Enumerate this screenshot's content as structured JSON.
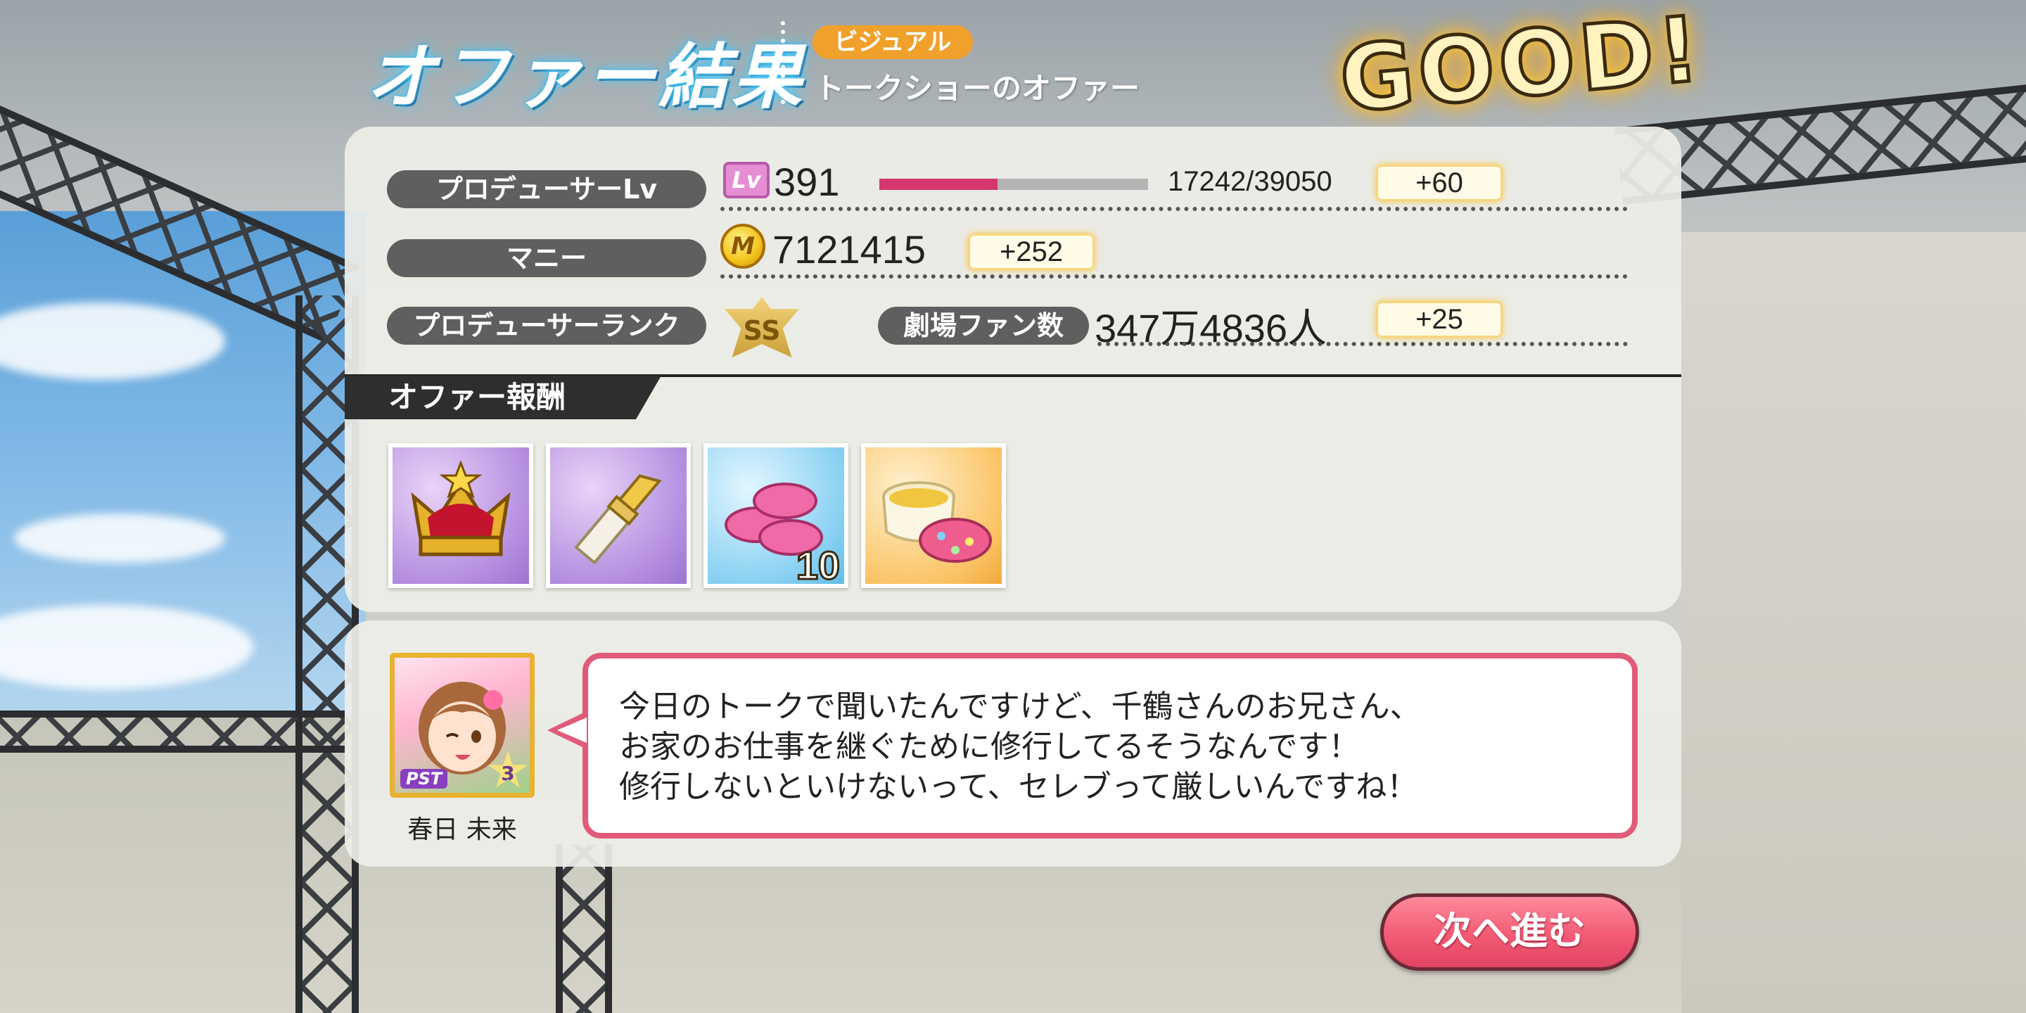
{
  "header": {
    "title": "オファー結果",
    "type_badge": "ビジュアル",
    "offer_name": "トークショーのオファー",
    "result": "GOOD!"
  },
  "stats": {
    "producer_lv": {
      "label": "プロデューサーLv",
      "icon": "Lv",
      "value": "391",
      "exp": "17242/39050",
      "exp_progress_fraction": 0.44,
      "gain": "+60",
      "progress_color": "#d4366e"
    },
    "money": {
      "label": "マニー",
      "icon": "M",
      "value": "7121415",
      "gain": "+252"
    },
    "rank": {
      "label": "プロデューサーランク",
      "badge": "SS"
    },
    "fans": {
      "label": "劇場ファン数",
      "value": "347万4836人",
      "gain": "+25"
    }
  },
  "rewards": {
    "section_label": "オファー報酬",
    "items": [
      {
        "icon": "crown-icon",
        "bg": "purple",
        "qty": ""
      },
      {
        "icon": "lipstick-icon",
        "bg": "purple",
        "qty": ""
      },
      {
        "icon": "macaron-icon",
        "bg": "blue",
        "qty": "10"
      },
      {
        "icon": "cosmetic-cream-icon",
        "bg": "orange",
        "qty": ""
      }
    ]
  },
  "dialogue": {
    "character_name": "春日 未来",
    "card_type": "PST",
    "card_level": "3",
    "lines": [
      "今日のトークで聞いたんですけど、千鶴さんのお兄さん、",
      "お家のお仕事を継ぐために修行してるそうなんです！",
      "修行しないといけないって、セレブって厳しいんですね！"
    ],
    "accent_color": "#e25a79"
  },
  "next_button": "次へ進む"
}
